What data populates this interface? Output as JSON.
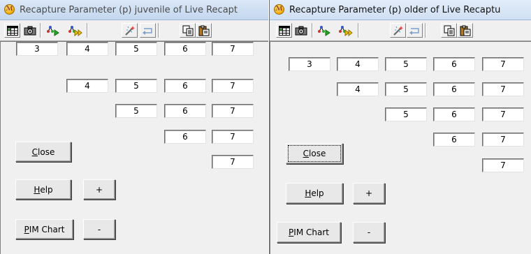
{
  "windows": {
    "left": {
      "title": "Recapture Parameter (p) juvenile of Live Recapt",
      "rows": [
        [
          "3",
          "4",
          "5",
          "6",
          "7"
        ],
        [
          "4",
          "5",
          "6",
          "7"
        ],
        [
          "5",
          "6",
          "7"
        ],
        [
          "6",
          "7"
        ],
        [
          "7"
        ]
      ],
      "buttons": {
        "close": {
          "mnemonic": "C",
          "rest": "lose"
        },
        "help": {
          "mnemonic": "H",
          "rest": "elp"
        },
        "plus": "+",
        "pim": {
          "mnemonic": "P",
          "rest": "IM Chart"
        },
        "minus": "-"
      }
    },
    "right": {
      "title": "Recapture Parameter (p) older of Live Recaptu",
      "rows": [
        [
          "3",
          "4",
          "5",
          "6",
          "7"
        ],
        [
          "4",
          "5",
          "6",
          "7"
        ],
        [
          "5",
          "6",
          "7"
        ],
        [
          "6",
          "7"
        ],
        [
          "7"
        ]
      ],
      "buttons": {
        "close": {
          "mnemonic": "C",
          "rest": "lose"
        },
        "help": {
          "mnemonic": "H",
          "rest": "elp"
        },
        "plus": "+",
        "pim": {
          "mnemonic": "P",
          "rest": "IM Chart"
        },
        "minus": "-"
      }
    }
  },
  "toolbar_icons": [
    "grid-icon",
    "camera-icon",
    "tree-play-icon",
    "tree-fast-forward-icon",
    "magic-wand-icon",
    "undo-icon",
    "copy-icon",
    "paste-icon"
  ],
  "colors": {
    "titlebar": "#c4d7ef",
    "face": "#f0f0f0",
    "cell": "#ffffff"
  }
}
